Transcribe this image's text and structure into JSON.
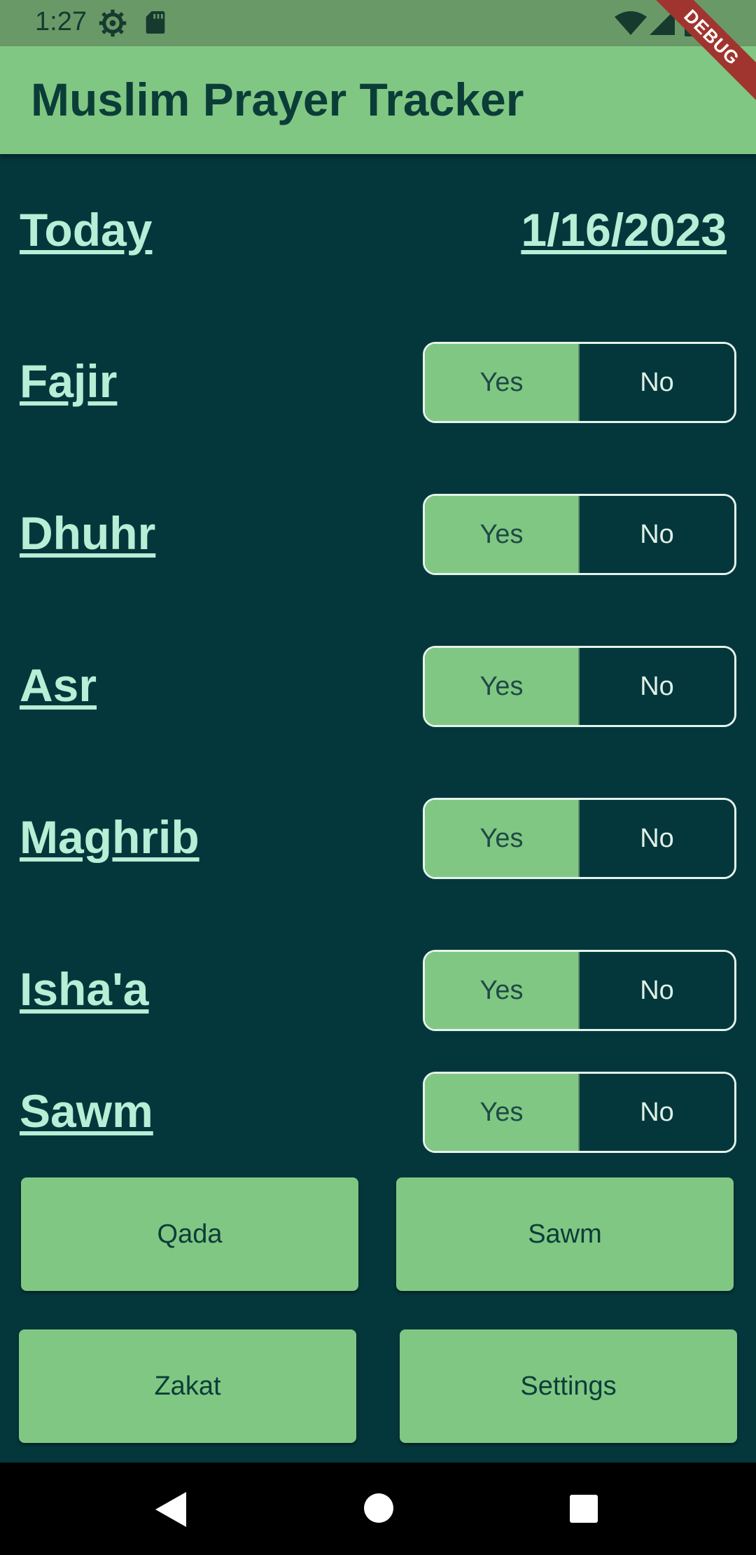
{
  "status_bar": {
    "time": "1:27"
  },
  "app_bar": {
    "title": "Muslim Prayer Tracker",
    "debug_label": "DEBUG"
  },
  "date_row": {
    "today_label": "Today",
    "date": "1/16/2023"
  },
  "prayers": [
    {
      "name": "Fajir",
      "yes_label": "Yes",
      "no_label": "No",
      "selected": "Yes"
    },
    {
      "name": "Dhuhr",
      "yes_label": "Yes",
      "no_label": "No",
      "selected": "Yes"
    },
    {
      "name": "Asr",
      "yes_label": "Yes",
      "no_label": "No",
      "selected": "Yes"
    },
    {
      "name": "Maghrib",
      "yes_label": "Yes",
      "no_label": "No",
      "selected": "Yes"
    },
    {
      "name": "Isha'a",
      "yes_label": "Yes",
      "no_label": "No",
      "selected": "Yes"
    },
    {
      "name": "Sawm",
      "yes_label": "Yes",
      "no_label": "No",
      "selected": "Yes"
    }
  ],
  "buttons": {
    "qada": "Qada",
    "sawm": "Sawm",
    "zakat": "Zakat",
    "settings": "Settings"
  },
  "colors": {
    "background": "#04373c",
    "app_bar": "#81c784",
    "accent_text": "#b6eed6",
    "debug_ribbon": "#a0352f"
  },
  "icons": [
    "gear-icon",
    "sd-card-icon",
    "wifi-icon",
    "signal-icon",
    "battery-icon",
    "back-icon",
    "home-icon",
    "recents-icon"
  ]
}
